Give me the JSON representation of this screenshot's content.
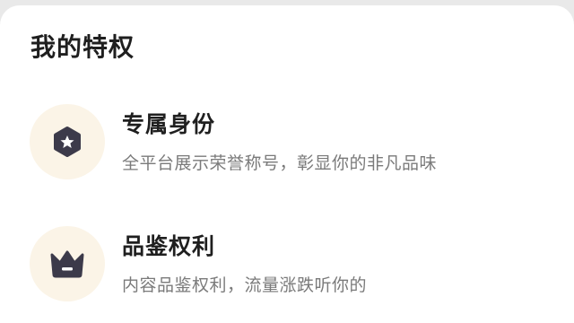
{
  "section": {
    "title": "我的特权"
  },
  "privileges": [
    {
      "title": "专属身份",
      "description": "全平台展示荣誉称号，彰显你的非凡品味",
      "icon": "hexagon-star-icon"
    },
    {
      "title": "品鉴权利",
      "description": "内容品鉴权利，流量涨跌听你的",
      "icon": "crown-icon"
    }
  ],
  "colors": {
    "icon_circle_bg": "#fbf4e7",
    "icon_fill": "#3c3a4a",
    "title_text": "#1f1f1f",
    "desc_text": "#7a7a7a",
    "card_bg": "#ffffff"
  }
}
